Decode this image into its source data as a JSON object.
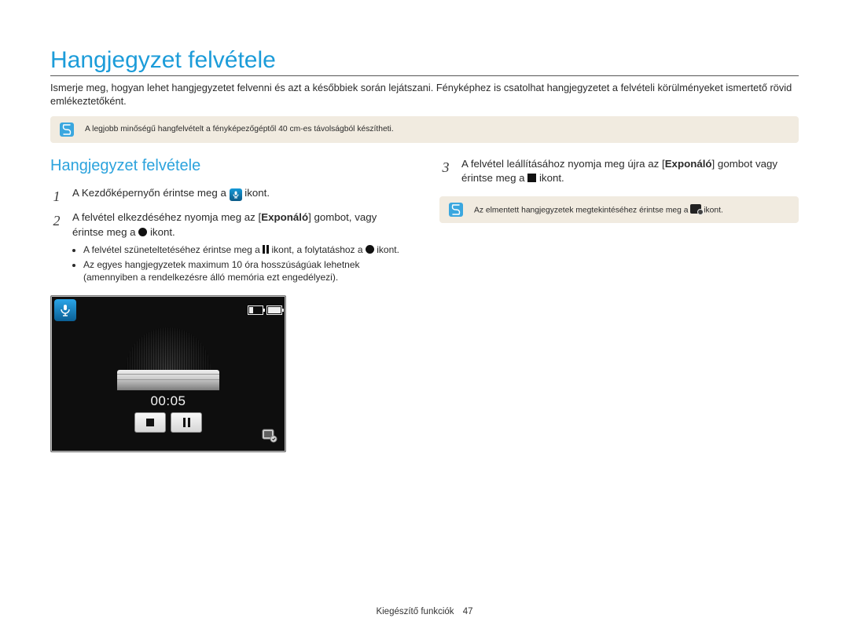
{
  "page_title": "Hangjegyzet felvétele",
  "intro": "Ismerje meg, hogyan lehet hangjegyzetet felvenni és azt a későbbiek során lejátszani. Fényképhez is csatolhat hangjegyzetet a felvételi körülményeket ismertető rövid emlékeztetőként.",
  "tip1": "A legjobb minőségű hangfelvételt a fényképezőgéptől 40 cm-es távolságból készítheti.",
  "left": {
    "heading": "Hangjegyzet felvétele",
    "step1_num": "1",
    "step1_a": "A Kezdőképernyőn érintse meg a ",
    "step1_b": " ikont.",
    "step2_num": "2",
    "step2_a": "A felvétel elkezdéséhez nyomja meg az [",
    "step2_bold": "Exponáló",
    "step2_b": "] gombot, vagy érintse meg a ",
    "step2_c": " ikont.",
    "step2_sub1_a": "A felvétel szüneteltetéséhez érintse meg a ",
    "step2_sub1_b": " ikont, a folytatáshoz a ",
    "step2_sub1_c": " ikont.",
    "step2_sub2": "Az egyes hangjegyzetek maximum 10 óra hosszúságúak lehetnek (amennyiben a rendelkezésre álló memória ezt engedélyezi).",
    "screen_timer": "00:05"
  },
  "right": {
    "step3_num": "3",
    "step3_a": "A felvétel leállításához nyomja meg újra az [",
    "step3_bold": "Exponáló",
    "step3_b": "] gombot vagy érintse meg a ",
    "step3_c": " ikont.",
    "tip2_a": "Az elmentett hangjegyzetek megtekintéséhez érintse meg a ",
    "tip2_b": " ikont."
  },
  "footer_section": "Kiegészítő funkciók",
  "footer_page": "47"
}
